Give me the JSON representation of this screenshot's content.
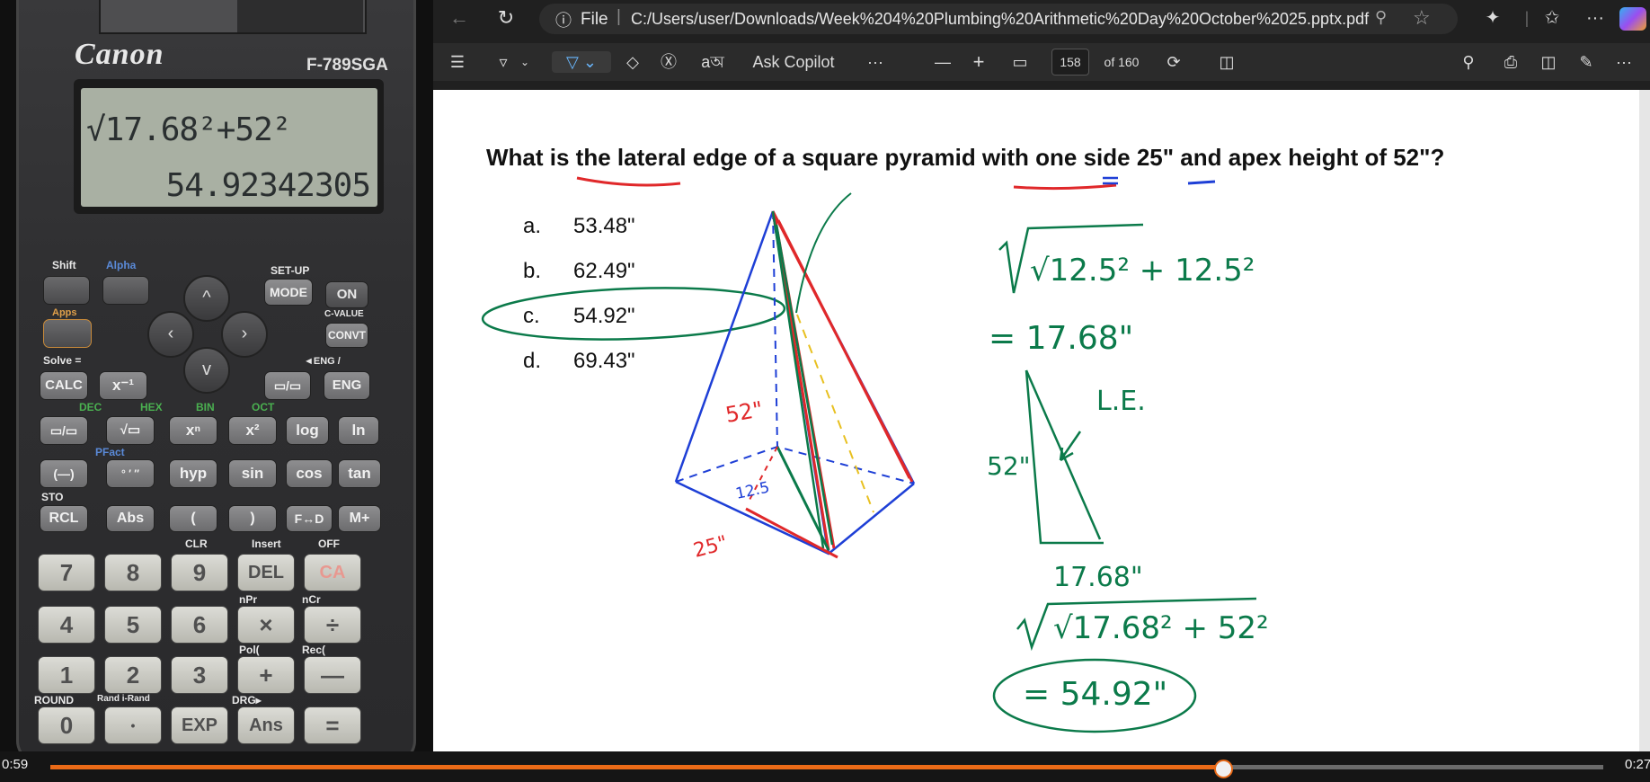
{
  "calculator": {
    "brand": "Canon",
    "model": "F-789SGA",
    "display_expression": "√17.68²+52²",
    "display_result": "54.92342305",
    "keys": {
      "shift": "Shift",
      "alpha": "Alpha",
      "apps": "Apps",
      "setup": "SET-UP",
      "mode": "MODE",
      "on": "ON",
      "c_value": "C-VALUE",
      "convt": "CONVT",
      "solve": "Solve =",
      "calc": "CALC",
      "inverse": "x⁻¹",
      "eng_top": "◄ENG /",
      "eng": "ENG",
      "fraction": "▭/▭",
      "sqrt": "√▭",
      "power": "xⁿ",
      "square": "x²",
      "log": "log",
      "ln": "ln",
      "negate": "(—)",
      "dms": "° ′ ″",
      "hyp": "hyp",
      "sin": "sin",
      "cos": "cos",
      "tan": "tan",
      "rcl": "RCL",
      "abs": "Abs",
      "paren_open": "(",
      "paren_close": ")",
      "f_to_d": "F↔D",
      "m_plus": "M+",
      "seven": "7",
      "eight": "8",
      "nine": "9",
      "del": "DEL",
      "ac": "CA",
      "four": "4",
      "five": "5",
      "six": "6",
      "times": "×",
      "divide": "÷",
      "one": "1",
      "two": "2",
      "three": "3",
      "plus": "+",
      "minus": "—",
      "zero": "0",
      "dot": "•",
      "exp": "EXP",
      "ans": "Ans",
      "equals": "="
    },
    "labels": {
      "dec": "DEC",
      "hex": "HEX",
      "bin": "BIN",
      "oct": "OCT",
      "pfact": "PFact",
      "sto": "STO",
      "clr": "CLR",
      "insert": "Insert",
      "off": "OFF",
      "npr": "nPr",
      "ncr": "nCr",
      "pol": "Pol(",
      "rec": "Rec(",
      "round": "ROUND",
      "rand": "Rand i-Rand",
      "drg": "DRG▸"
    }
  },
  "browser": {
    "file_label": "File",
    "address": "C:/Users/user/Downloads/Week%204%20Plumbing%20Arithmetic%20Day%20October%2025.pptx.pdf",
    "ask_copilot": "Ask Copilot",
    "page_number": "158",
    "page_total": "of 160",
    "more": "···",
    "minus": "—",
    "plus": "+"
  },
  "slide": {
    "question": "What is the lateral edge of a square pyramid with one side 25\" and apex height of 52\"?",
    "options": [
      {
        "letter": "a.",
        "value": "53.48\""
      },
      {
        "letter": "b.",
        "value": "62.49\""
      },
      {
        "letter": "c.",
        "value": "54.92\""
      },
      {
        "letter": "d.",
        "value": "69.43\""
      }
    ],
    "handwriting": {
      "step1": "√12.5² + 12.5²",
      "step1_result": "= 17.68\"",
      "le_label": "L.E.",
      "height_label": "52\"",
      "base_label": "17.68\"",
      "step2": "√17.68² + 52²",
      "answer": "= 54.92\"",
      "pyramid_height": "52\"",
      "pyramid_half": "12.5",
      "pyramid_side": "25\""
    },
    "colors": {
      "green": "#0b7a4a",
      "red": "#e0282a",
      "blue": "#1e3fd6",
      "yellow": "#e8c020"
    }
  },
  "video": {
    "time_left": "0:59",
    "time_right": "0:27",
    "progress": 0.755
  }
}
